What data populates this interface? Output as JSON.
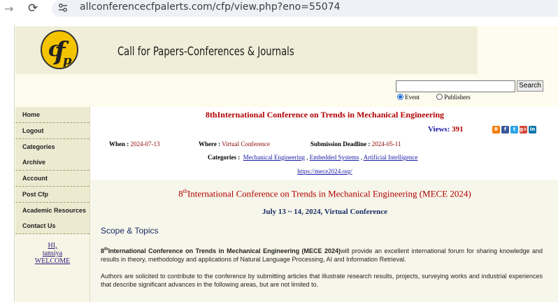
{
  "browser": {
    "url": "allconferencecfpalerts.com/cfp/view.php?eno=55074",
    "back_icon": "back-arrow-icon",
    "reload_icon": "reload-icon",
    "site_info_icon": "tune-icon"
  },
  "header": {
    "logo_text": "cfp",
    "site_title": "Call for Papers-Conferences & Journals",
    "search_placeholder": "",
    "search_button": "Search",
    "radio_event": "Event",
    "radio_publishers": "Publishers",
    "selected_radio": "Event"
  },
  "sidebar": {
    "items": [
      {
        "label": "Home"
      },
      {
        "label": "Logout"
      },
      {
        "label": "Categories"
      },
      {
        "label": "Archive"
      },
      {
        "label": "Account"
      },
      {
        "label": "Post Cfp"
      },
      {
        "label": "Academic Resources"
      },
      {
        "label": "Contact Us"
      }
    ],
    "welcome_line1": "HI,",
    "welcome_line2": "tansiya",
    "welcome_line3": "WELCOME"
  },
  "conference": {
    "title": "8thInternational Conference on Trends in Mechanical Engineering",
    "views_label": "Views:",
    "views_count": "391",
    "when_label": "When :",
    "when_value": "2024-07-13",
    "where_label": "Where :",
    "where_value": "Virtual Conference",
    "deadline_label": "Submission Deadline :",
    "deadline_value": "2024-05-11",
    "categories_label": "Categories :",
    "categories": [
      "Mechanical Engineering",
      "Embedded Systems",
      "Artificial Intelligence"
    ],
    "url": "https://mece2024.org/"
  },
  "detail": {
    "title_prefix": "8",
    "title_sup": "th",
    "title_rest": "International Conference on Trends in Mechanical Engineering (MECE 2024)",
    "subtitle": "July 13 ~ 14, 2024, Virtual Conference",
    "scope_heading": "Scope & Topics",
    "p1_num": "8",
    "p1_sup": "th",
    "p1_bold": "International Conference on Trends in Mechanical Engineering (MECE 2024)",
    "p1_rest": "will provide an excellent international forum for sharing knowledge and results in theory, methodology and applications of Natural Language Processing, AI and Information Retrieval.",
    "p2": "Authors are solicited to contribute to the conference by submitting articles that illustrate research results, projects, surveying works and industrial experiences that describe significant advances in the following areas, but are not limited to."
  },
  "social": [
    {
      "icon": "blogger-icon",
      "color": "#f57d00",
      "glyph": "B"
    },
    {
      "icon": "facebook-icon",
      "color": "#3b5998",
      "glyph": "f"
    },
    {
      "icon": "twitter-icon",
      "color": "#2fa4e7",
      "glyph": "t"
    },
    {
      "icon": "google-plus-icon",
      "color": "#d34836",
      "glyph": "g+"
    },
    {
      "icon": "linkedin-icon",
      "color": "#0e76a8",
      "glyph": "in"
    }
  ],
  "colors": {
    "accent_red": "#b00000",
    "link_blue": "#1a1aa6",
    "header_bg": "#fdfcee",
    "menu_bg": "#ecead1"
  }
}
